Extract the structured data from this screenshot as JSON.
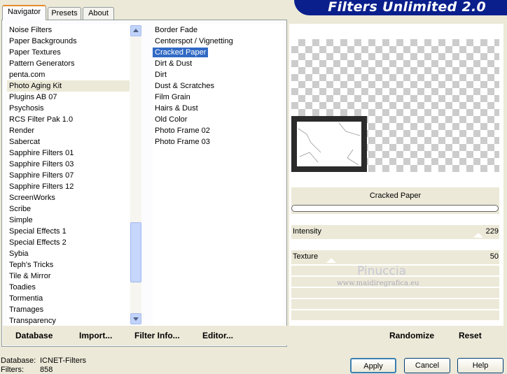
{
  "title": "Filters Unlimited 2.0",
  "tabs": [
    {
      "label": "Navigator"
    },
    {
      "label": "Presets"
    },
    {
      "label": "About"
    }
  ],
  "categories": [
    "Noise Filters",
    "Paper Backgrounds",
    "Paper Textures",
    "Pattern Generators",
    "penta.com",
    "Photo Aging Kit",
    "Plugins AB 07",
    "Psychosis",
    "RCS Filter Pak 1.0",
    "Render",
    "Sabercat",
    "Sapphire Filters 01",
    "Sapphire Filters 03",
    "Sapphire Filters 07",
    "Sapphire Filters 12",
    "ScreenWorks",
    "Scribe",
    "Simple",
    "Special Effects 1",
    "Special Effects 2",
    "Sybia",
    "Teph's Tricks",
    "Tile & Mirror",
    "Toadies",
    "Tormentia",
    "Tramages",
    "Transparency"
  ],
  "selected_category": "Photo Aging Kit",
  "filters": [
    "Border Fade",
    "Centerspot / Vignetting",
    "Cracked Paper",
    "Dirt & Dust",
    "Dirt",
    "Dust & Scratches",
    "Film Grain",
    "Hairs & Dust",
    "Old Color",
    "Photo Frame 02",
    "Photo Frame 03"
  ],
  "selected_filter": "Cracked Paper",
  "left_buttons": {
    "database": "Database",
    "import": "Import...",
    "filter_info": "Filter Info...",
    "editor": "Editor..."
  },
  "filter_name": "Cracked Paper",
  "sliders": [
    {
      "label": "Intensity",
      "value": "229"
    },
    {
      "label": "Texture",
      "value": "50"
    }
  ],
  "watermark": {
    "name": "Pinuccia",
    "url": "www.maidiregrafica.eu"
  },
  "right_buttons": {
    "randomize": "Randomize",
    "reset": "Reset"
  },
  "status": {
    "database_label": "Database:",
    "database_value": "ICNET-Filters",
    "filters_label": "Filters:",
    "filters_value": "858"
  },
  "dialog_buttons": {
    "apply": "Apply",
    "cancel": "Cancel",
    "help": "Help"
  }
}
